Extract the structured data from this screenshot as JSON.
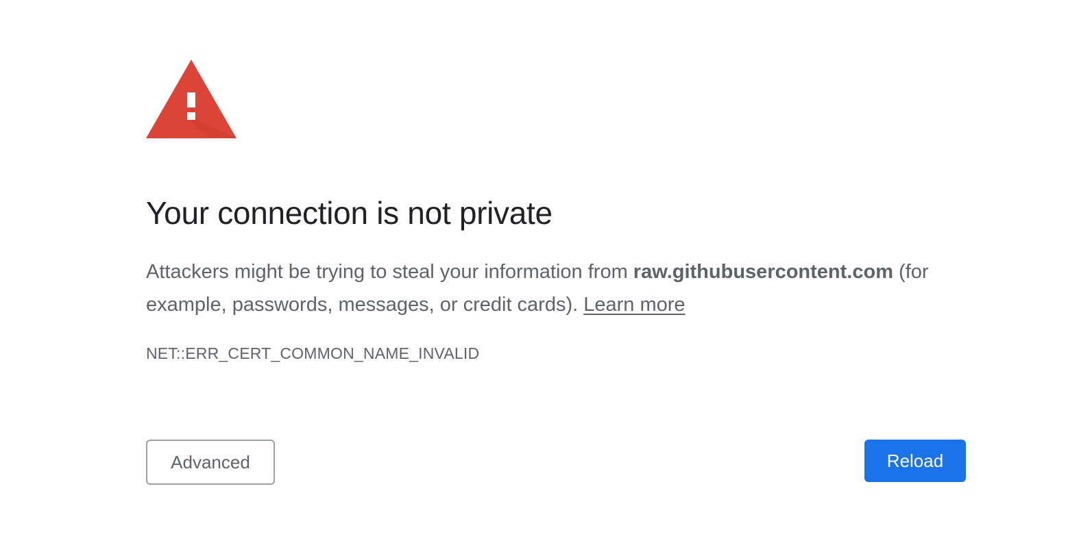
{
  "page": {
    "title": "Your connection is not private",
    "explanation_prefix": "Attackers might be trying to steal your information from ",
    "hostname": "raw.githubusercontent.com",
    "explanation_suffix": " (for example, passwords, messages, or credit cards). ",
    "learn_more_label": "Learn more",
    "error_code": "NET::ERR_CERT_COMMON_NAME_INVALID"
  },
  "buttons": {
    "advanced_label": "Advanced",
    "reload_label": "Reload"
  },
  "icons": {
    "warning": "warning-triangle-icon"
  },
  "colors": {
    "warning_red": "#db4437",
    "primary_blue": "#1a73e8",
    "title_text": "#202124",
    "body_text": "#5f6368"
  }
}
